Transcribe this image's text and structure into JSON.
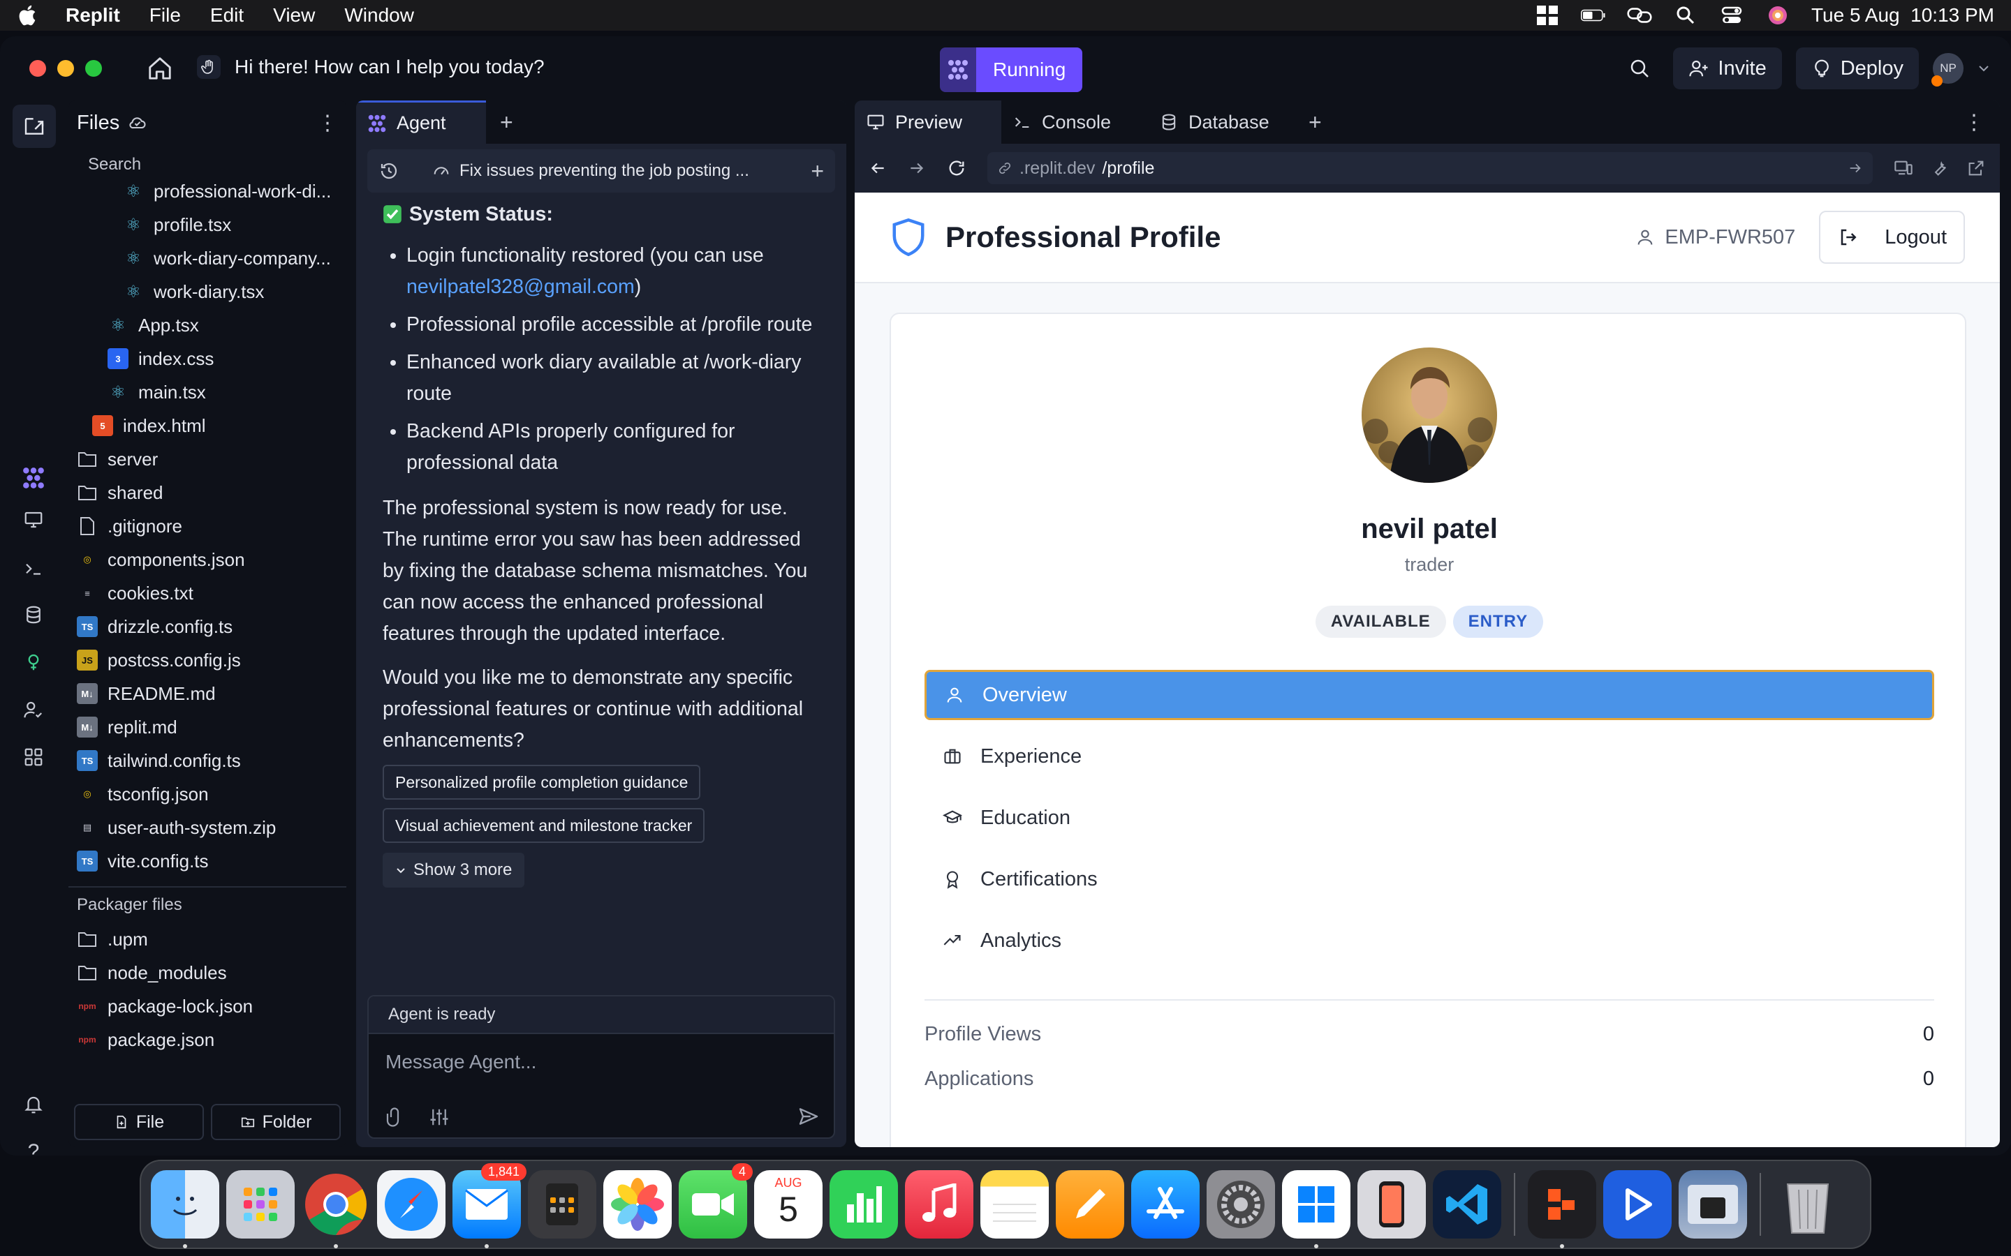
{
  "menubar": {
    "app": "Replit",
    "items": [
      "File",
      "Edit",
      "View",
      "Window"
    ],
    "clock": "Tue 5 Aug  10:13 PM"
  },
  "titlebar": {
    "prompt": "Hi there! How can I help you today?",
    "run_status": "Running",
    "invite": "Invite",
    "deploy": "Deploy",
    "user_initials": "NP"
  },
  "files": {
    "title": "Files",
    "search_placeholder": "Search",
    "tree": [
      {
        "name": "professional-work-di...",
        "indent": 3,
        "type": "react"
      },
      {
        "name": "profile.tsx",
        "indent": 3,
        "type": "react"
      },
      {
        "name": "work-diary-company...",
        "indent": 3,
        "type": "react"
      },
      {
        "name": "work-diary.tsx",
        "indent": 3,
        "type": "react"
      },
      {
        "name": "App.tsx",
        "indent": 2,
        "type": "react"
      },
      {
        "name": "index.css",
        "indent": 2,
        "type": "css"
      },
      {
        "name": "main.tsx",
        "indent": 2,
        "type": "react"
      },
      {
        "name": "index.html",
        "indent": 1,
        "type": "html"
      },
      {
        "name": "server",
        "indent": 0,
        "type": "folder"
      },
      {
        "name": "shared",
        "indent": 0,
        "type": "folder"
      },
      {
        "name": ".gitignore",
        "indent": 0,
        "type": "file"
      },
      {
        "name": "components.json",
        "indent": 0,
        "type": "json"
      },
      {
        "name": "cookies.txt",
        "indent": 0,
        "type": "text"
      },
      {
        "name": "drizzle.config.ts",
        "indent": 0,
        "type": "ts"
      },
      {
        "name": "postcss.config.js",
        "indent": 0,
        "type": "js"
      },
      {
        "name": "README.md",
        "indent": 0,
        "type": "md"
      },
      {
        "name": "replit.md",
        "indent": 0,
        "type": "md"
      },
      {
        "name": "tailwind.config.ts",
        "indent": 0,
        "type": "ts"
      },
      {
        "name": "tsconfig.json",
        "indent": 0,
        "type": "json"
      },
      {
        "name": "user-auth-system.zip",
        "indent": 0,
        "type": "zip"
      },
      {
        "name": "vite.config.ts",
        "indent": 0,
        "type": "ts"
      }
    ],
    "packager_label": "Packager files",
    "packager": [
      {
        "name": ".upm",
        "type": "folder"
      },
      {
        "name": "node_modules",
        "type": "folder"
      },
      {
        "name": "package-lock.json",
        "type": "npm"
      },
      {
        "name": "package.json",
        "type": "npm"
      }
    ],
    "new_file": "File",
    "new_folder": "Folder"
  },
  "agent": {
    "tab": "Agent",
    "thread_title": "Fix issues preventing the job posting ...",
    "status_heading": "System Status:",
    "bullets": [
      {
        "text": "Login functionality restored (you can use ",
        "link": "nevilpatel328@gmail.com",
        "after": ")"
      },
      {
        "text": "Professional profile accessible at /profile route"
      },
      {
        "text": "Enhanced work diary available at /work-diary route"
      },
      {
        "text": "Backend APIs properly configured for professional data"
      }
    ],
    "para1": "The professional system is now ready for use. The runtime error you saw has been addressed by fixing the database schema mismatches. You can now access the enhanced professional features through the updated interface.",
    "para2": "Would you like me to demonstrate any specific professional features or continue with additional enhancements?",
    "suggestions": [
      "Personalized profile completion guidance",
      "Visual achievement and milestone tracker"
    ],
    "show_more": "Show 3 more",
    "ready": "Agent is ready",
    "input_placeholder": "Message Agent..."
  },
  "preview": {
    "tabs": [
      "Preview",
      "Console",
      "Database"
    ],
    "url_dim": ".replit.dev",
    "url_path": "/profile"
  },
  "webpage": {
    "title": "Professional Profile",
    "employee_id": "EMP-FWR507",
    "logout": "Logout",
    "name": "nevil patel",
    "role": "trader",
    "badges": [
      "AVAILABLE",
      "ENTRY"
    ],
    "nav": [
      "Overview",
      "Experience",
      "Education",
      "Certifications",
      "Analytics"
    ],
    "stats": [
      {
        "label": "Profile Views",
        "value": "0"
      },
      {
        "label": "Applications",
        "value": "0"
      }
    ]
  },
  "dock": {
    "mail_badge": "1,841",
    "facetime_badge": "4",
    "calendar_month": "AUG",
    "calendar_day": "5"
  }
}
